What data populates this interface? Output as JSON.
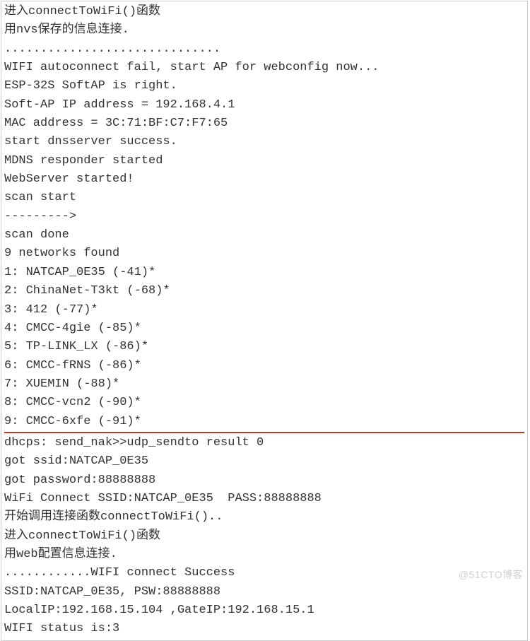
{
  "terminal": {
    "lines_top": [
      "进入connectToWiFi()函数",
      "用nvs保存的信息连接.",
      "..............................",
      "WIFI autoconnect fail, start AP for webconfig now...",
      "ESP-32S SoftAP is right.",
      "Soft-AP IP address = 192.168.4.1",
      "MAC address = 3C:71:BF:C7:F7:65",
      "start dnsserver success.",
      "MDNS responder started",
      "WebServer started!",
      "scan start",
      "--------->",
      "scan done",
      "9 networks found",
      "1: NATCAP_0E35 (-41)*",
      "2: ChinaNet-T3kt (-68)*",
      "3: 412 (-77)*",
      "4: CMCC-4gie (-85)*",
      "5: TP-LINK_LX (-86)*",
      "6: CMCC-fRNS (-86)*",
      "7: XUEMIN (-88)*",
      "8: CMCC-vcn2 (-90)*",
      "9: CMCC-6xfe (-91)*"
    ],
    "lines_bottom": [
      "dhcps: send_nak>>udp_sendto result 0",
      "got ssid:NATCAP_0E35",
      "got password:88888888",
      "WiFi Connect SSID:NATCAP_0E35  PASS:88888888",
      "开始调用连接函数connectToWiFi()..",
      "进入connectToWiFi()函数",
      "用web配置信息连接.",
      "............WIFI connect Success",
      "SSID:NATCAP_0E35, PSW:88888888",
      "LocalIP:192.168.15.104 ,GateIP:192.168.15.1",
      "WIFI status is:3"
    ]
  },
  "watermark": "@51CTO博客"
}
